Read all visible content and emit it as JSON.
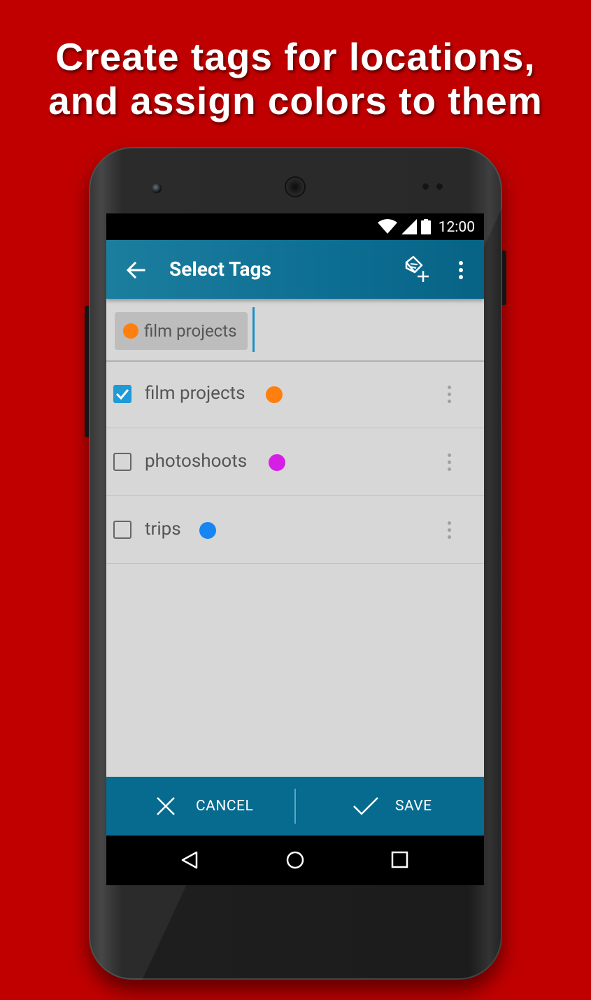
{
  "headline": {
    "line1": "Create tags for locations,",
    "line2": "and assign colors to them"
  },
  "colors": {
    "background": "#c00000",
    "toolbar": "#0d6e93",
    "action_bar": "#066b8f",
    "accent": "#1e9ad6"
  },
  "status_bar": {
    "time": "12:00",
    "icons": [
      "wifi-icon",
      "signal-icon",
      "battery-icon"
    ]
  },
  "toolbar": {
    "back_icon": "back-arrow-icon",
    "title": "Select Tags",
    "add_tag_icon": "add-tag-icon",
    "overflow_icon": "more-vert-icon"
  },
  "selected_chips": [
    {
      "label": "film projects",
      "color": "#ff7f0e"
    }
  ],
  "tags": [
    {
      "name": "film projects",
      "color": "#ff7f0e",
      "checked": true
    },
    {
      "name": "photoshoots",
      "color": "#d51fe6",
      "checked": false
    },
    {
      "name": "trips",
      "color": "#1785f2",
      "checked": false
    }
  ],
  "actions": {
    "cancel_label": "CANCEL",
    "save_label": "SAVE"
  },
  "nav_bar": {
    "icons": [
      "back-triangle-icon",
      "home-circle-icon",
      "recents-square-icon"
    ]
  }
}
